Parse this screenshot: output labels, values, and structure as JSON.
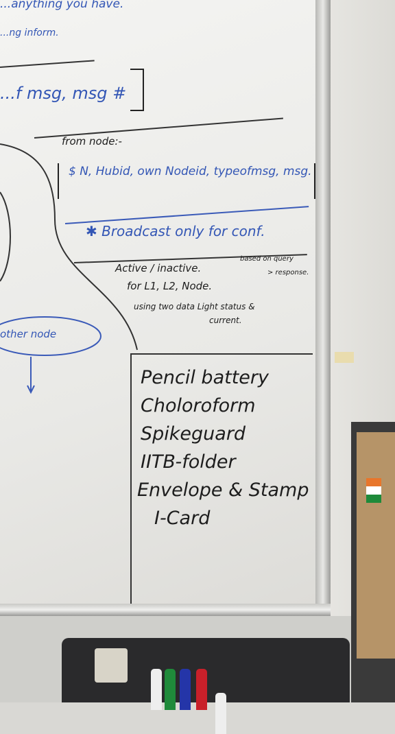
{
  "whiteboard": {
    "top_notes": [
      "...anything you have.",
      "...ng inform."
    ],
    "bracket_line": "...f msg, msg #",
    "from_node": {
      "heading": "from node:-",
      "fields": "$ N, Hubid, own Nodeid, typeofmsg, msg. #"
    },
    "broadcast": "✱ Broadcast only for conf.",
    "status_notes": {
      "line1": "Active / inactive.",
      "side_note": "based on query",
      "line2": "for L1, L2, Node.",
      "side_note2": "> response.",
      "line3": "using two data Light status &",
      "line4": "current."
    },
    "other_node": "other node",
    "checklist": [
      "Pencil battery",
      "Choloroform",
      "Spikeguard",
      "IITB-folder",
      "Envelope & Stamp",
      "I-Card"
    ]
  },
  "colors": {
    "blue_marker": "#3356b5",
    "black_marker": "#1c1c1c",
    "board": "#f0f0ee"
  }
}
